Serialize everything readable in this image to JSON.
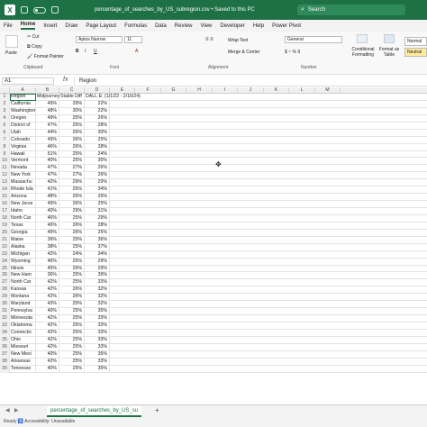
{
  "titlebar": {
    "logo": "X",
    "doc_title": "percentage_of_searches_by_US_subregion.csv • Saved to this PC",
    "search_placeholder": "Search"
  },
  "menu": [
    "File",
    "Home",
    "Insert",
    "Draw",
    "Page Layout",
    "Formulas",
    "Data",
    "Review",
    "View",
    "Developer",
    "Help",
    "Power Pivot"
  ],
  "menu_active": "Home",
  "ribbon": {
    "paste": "Paste",
    "cut": "Cut",
    "copy": "Copy",
    "format_painter": "Format Painter",
    "font_name": "Aptos Narrow",
    "font_size": "11",
    "wrap_text": "Wrap Text",
    "merge_center": "Merge & Center",
    "number_format": "General",
    "cond_fmt": "Conditional Formatting",
    "format_table": "Format as Table",
    "style_normal": "Normal",
    "style_neutral": "Neutral",
    "groups": {
      "clipboard": "Clipboard",
      "font": "Font",
      "alignment": "Alignment",
      "number": "Number"
    }
  },
  "formula": {
    "namebox": "A1",
    "fx": "fx",
    "content": "Region"
  },
  "columns": [
    "A",
    "B",
    "C",
    "D",
    "E",
    "F",
    "G",
    "H",
    "I",
    "J",
    "K",
    "L",
    "M"
  ],
  "headers": [
    "Region",
    "Midjourney",
    "Stable Diff",
    "DALL·E: (1/1/22 - 2/16/24)"
  ],
  "rows": [
    [
      "California",
      "49%",
      "29%",
      "22%"
    ],
    [
      "Washington",
      "48%",
      "30%",
      "22%"
    ],
    [
      "Oregon",
      "49%",
      "25%",
      "26%"
    ],
    [
      "District of",
      "47%",
      "25%",
      "28%"
    ],
    [
      "Utah",
      "44%",
      "26%",
      "30%"
    ],
    [
      "Colorado",
      "49%",
      "26%",
      "25%"
    ],
    [
      "Virginia",
      "46%",
      "26%",
      "28%"
    ],
    [
      "Hawaii",
      "51%",
      "25%",
      "24%"
    ],
    [
      "Vermont",
      "40%",
      "25%",
      "35%"
    ],
    [
      "Nevada",
      "47%",
      "27%",
      "26%"
    ],
    [
      "New York",
      "47%",
      "27%",
      "26%"
    ],
    [
      "Massachu",
      "42%",
      "29%",
      "29%"
    ],
    [
      "Rhode Isla",
      "41%",
      "25%",
      "34%"
    ],
    [
      "Arizona",
      "48%",
      "26%",
      "26%"
    ],
    [
      "New Jerse",
      "49%",
      "26%",
      "25%"
    ],
    [
      "Idaho",
      "40%",
      "29%",
      "31%"
    ],
    [
      "North Car",
      "46%",
      "25%",
      "29%"
    ],
    [
      "Texas",
      "46%",
      "26%",
      "28%"
    ],
    [
      "Georgia",
      "49%",
      "26%",
      "25%"
    ],
    [
      "Maine",
      "39%",
      "25%",
      "36%"
    ],
    [
      "Alaska",
      "38%",
      "25%",
      "37%"
    ],
    [
      "Michigan",
      "42%",
      "24%",
      "34%"
    ],
    [
      "Wyoming",
      "46%",
      "25%",
      "29%"
    ],
    [
      "Illinois",
      "45%",
      "26%",
      "29%"
    ],
    [
      "New Ham",
      "36%",
      "25%",
      "39%"
    ],
    [
      "North Car",
      "42%",
      "25%",
      "33%"
    ],
    [
      "Kansas",
      "42%",
      "26%",
      "32%"
    ],
    [
      "Montana",
      "42%",
      "26%",
      "32%"
    ],
    [
      "Maryland",
      "43%",
      "25%",
      "32%"
    ],
    [
      "Pennsylva",
      "40%",
      "25%",
      "35%"
    ],
    [
      "Minnesota",
      "42%",
      "25%",
      "33%"
    ],
    [
      "Oklahoma",
      "42%",
      "25%",
      "33%"
    ],
    [
      "Connectic",
      "42%",
      "25%",
      "33%"
    ],
    [
      "Ohio",
      "42%",
      "25%",
      "33%"
    ],
    [
      "Missouri",
      "42%",
      "25%",
      "33%"
    ],
    [
      "New Mexi",
      "40%",
      "25%",
      "35%"
    ],
    [
      "Arkansas",
      "42%",
      "25%",
      "33%"
    ],
    [
      "Tennesse",
      "40%",
      "25%",
      "35%"
    ]
  ],
  "sheet": {
    "tab": "percentage_of_searches_by_US_su",
    "add": "+"
  },
  "status": {
    "left": "Ready   ♿ Accessibility: Unavailable"
  }
}
